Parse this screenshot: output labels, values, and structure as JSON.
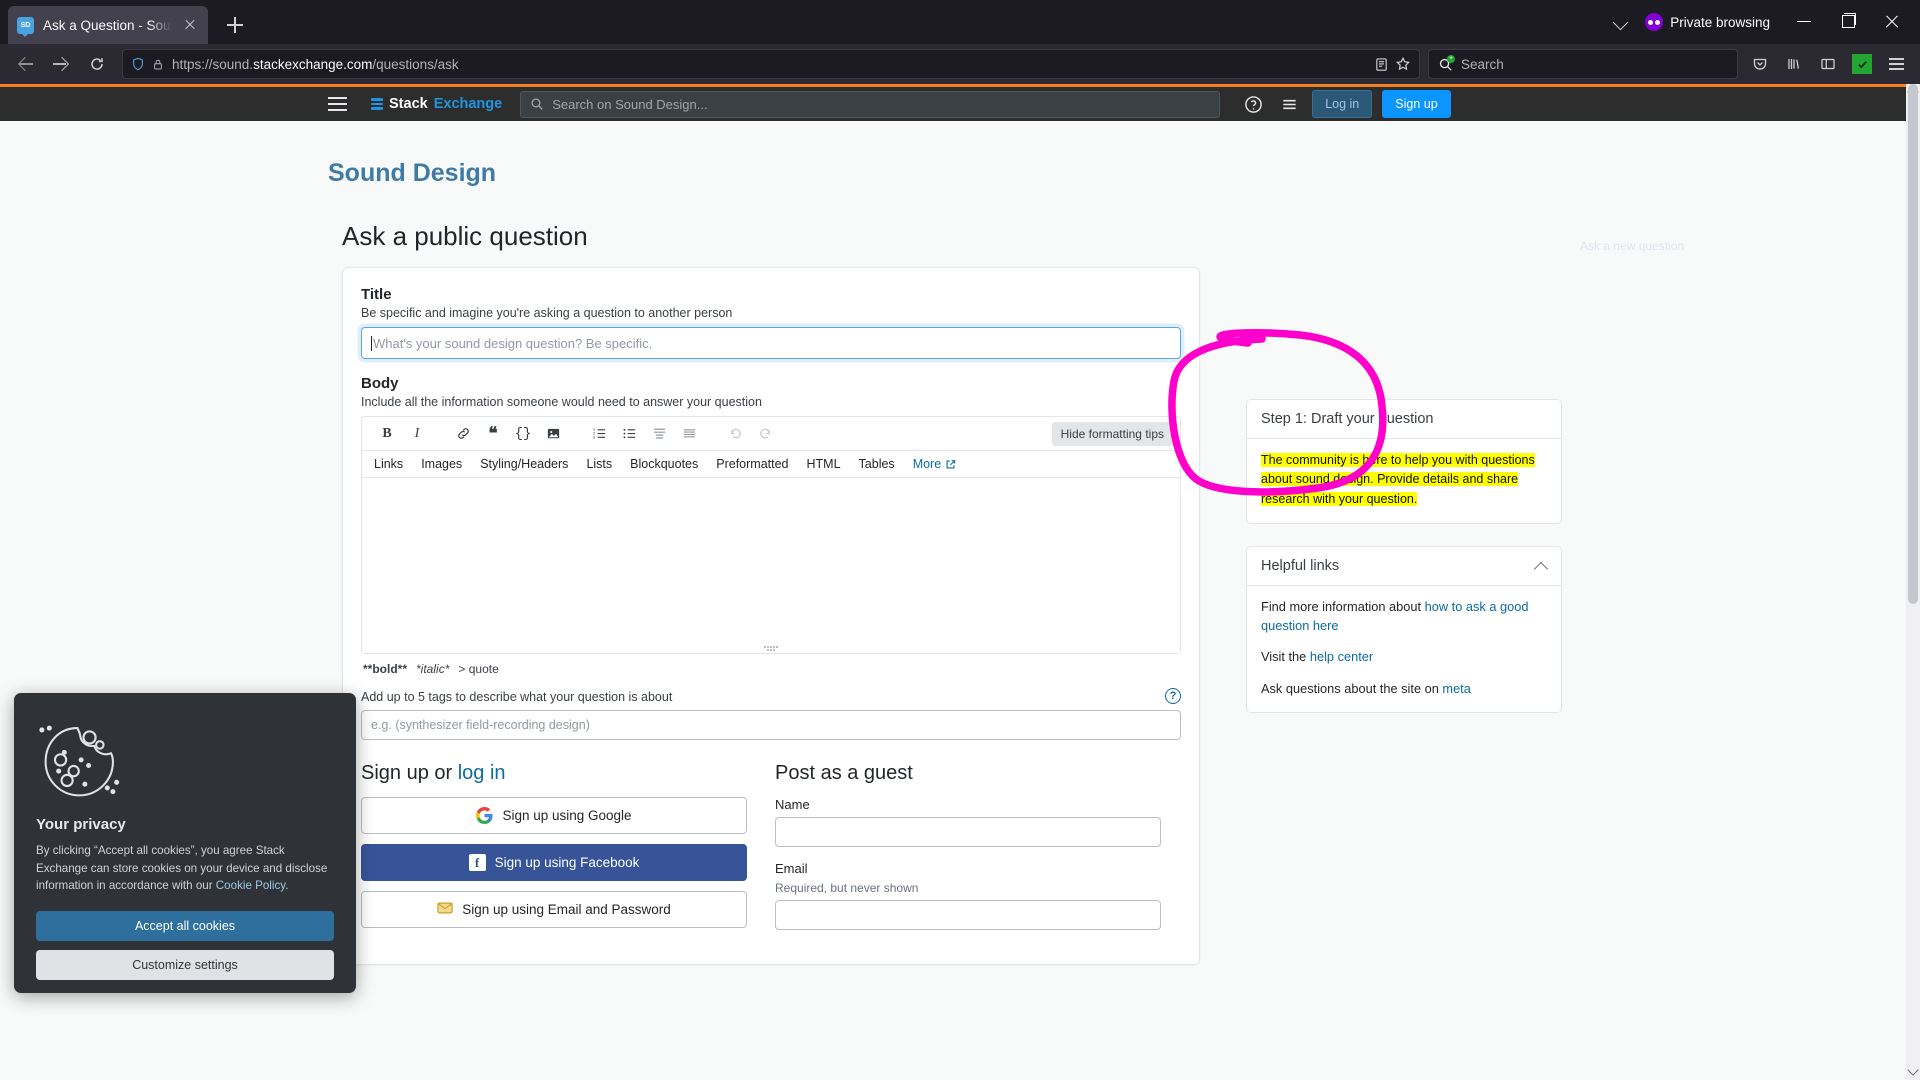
{
  "browser": {
    "tab": {
      "title": "Ask a Question - Sound Design",
      "favicon_label": "SD"
    },
    "new_tab_label": "+",
    "private_browsing_label": "Private browsing",
    "url": {
      "prefix": "https://sound.",
      "domain": "stackexchange.com",
      "path": "/questions/ask"
    },
    "search_placeholder": "Search",
    "icons": {
      "back": "back-arrow-icon",
      "forward": "forward-arrow-icon",
      "reload": "reload-icon",
      "shield": "shield-icon",
      "lock": "lock-icon",
      "reader": "reader-view-icon",
      "bookmark": "star-icon",
      "search": "search-add-icon",
      "pocket": "pocket-icon",
      "library": "library-icon",
      "sidebar": "sidebar-icon",
      "extension": "extension-checkmark-icon",
      "app_menu": "hamburger-menu-icon"
    }
  },
  "site_header": {
    "logo_text_1": "Stack",
    "logo_text_2": "Exchange",
    "search_placeholder": "Search on Sound Design...",
    "login_label": "Log in",
    "signup_label": "Sign up"
  },
  "page": {
    "site_title": "Sound Design",
    "heading": "Ask a public question",
    "ghost_text": "Ask a new question"
  },
  "form": {
    "title": {
      "label": "Title",
      "hint": "Be specific and imagine you're asking a question to another person",
      "placeholder": "What's your sound design question? Be specific.",
      "value": ""
    },
    "body": {
      "label": "Body",
      "hint": "Include all the information someone would need to answer your question",
      "value": ""
    },
    "editor": {
      "hide_tips_label": "Hide formatting tips",
      "toolbar_icons": [
        "bold-icon",
        "italic-icon",
        "link-icon",
        "blockquote-icon",
        "code-icon",
        "image-icon",
        "ordered-list-icon",
        "bullet-list-icon",
        "heading-icon",
        "horizontal-rule-icon",
        "undo-icon",
        "redo-icon"
      ],
      "tips_links": [
        "Links",
        "Images",
        "Styling/Headers",
        "Lists",
        "Blockquotes",
        "Preformatted",
        "HTML",
        "Tables"
      ],
      "more_label": "More",
      "markdown_hints": [
        "**bold**",
        "*italic*",
        "> quote"
      ]
    },
    "tags": {
      "hint": "Add up to 5 tags to describe what your question is about",
      "placeholder": "e.g. (synthesizer field-recording design)",
      "help_icon": "question-mark-icon"
    },
    "signup": {
      "heading_prefix": "Sign up or ",
      "heading_link": "log in",
      "google_label": "Sign up using Google",
      "facebook_label": "Sign up using Facebook",
      "email_label": "Sign up using Email and Password",
      "guest_heading": "Post as a guest",
      "name_label": "Name",
      "name_value": "",
      "email_label_field": "Email",
      "email_hint": "Required, but never shown",
      "email_value": ""
    }
  },
  "sidebar": {
    "step_card": {
      "title": "Step 1: Draft your question",
      "highlight": "The community is here to help you with questions about sound design. Provide details and share research with your question."
    },
    "helpful_links": {
      "title": "Helpful links",
      "collapse_icon": "chevron-up-icon",
      "rows": [
        {
          "text": "Find more information about ",
          "link": "how to ask a good question here",
          "after": ""
        },
        {
          "text": "Visit the ",
          "link": "help center",
          "after": ""
        },
        {
          "text": "Ask questions about the site on ",
          "link": "meta",
          "after": ""
        }
      ]
    }
  },
  "cookie_dialog": {
    "icon": "cookie-icon",
    "title": "Your privacy",
    "body_prefix": "By clicking “Accept all cookies”, you agree Stack Exchange can store cookies on your device and disclose information in accordance with our ",
    "policy_link": "Cookie Policy",
    "body_suffix": ".",
    "accept_label": "Accept all cookies",
    "customize_label": "Customize settings"
  },
  "annotation": {
    "color": "#ff00cc",
    "shape": "hand-drawn-ellipse-around-step1-card"
  },
  "colors": {
    "accent_blue": "#0a95ff",
    "site_title": "#3e7ba6",
    "highlight_yellow": "#ffff00",
    "annotation_magenta": "#ff00cc",
    "orange_top": "#f48024",
    "facebook_blue": "#385499"
  }
}
